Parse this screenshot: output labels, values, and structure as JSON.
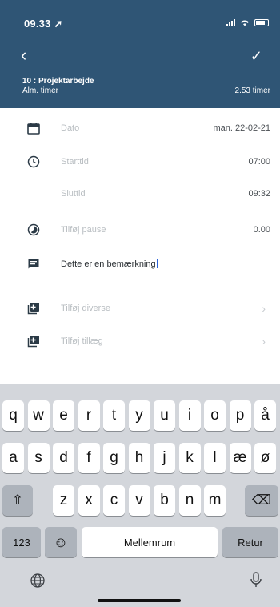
{
  "status_bar": {
    "time": "09.33"
  },
  "header": {
    "project_title": "10 : Projektarbejde",
    "hour_type": "Alm. timer",
    "total_hours": "2.53 timer"
  },
  "form": {
    "date_label": "Dato",
    "date_value": "man. 22-02-21",
    "start_label": "Starttid",
    "start_value": "07:00",
    "end_label": "Sluttid",
    "end_value": "09:32",
    "pause_label": "Tilføj pause",
    "pause_value": "0.00",
    "remark_value": "Dette er en bemærkning",
    "misc_label": "Tilføj diverse",
    "supplement_label": "Tilføj tillæg"
  },
  "keyboard": {
    "row1": [
      "q",
      "w",
      "e",
      "r",
      "t",
      "y",
      "u",
      "i",
      "o",
      "p",
      "å"
    ],
    "row2": [
      "a",
      "s",
      "d",
      "f",
      "g",
      "h",
      "j",
      "k",
      "l",
      "æ",
      "ø"
    ],
    "row3": [
      "z",
      "x",
      "c",
      "v",
      "b",
      "n",
      "m"
    ],
    "numbers_key": "123",
    "space_key": "Mellemrum",
    "return_key": "Retur"
  },
  "colors": {
    "header_bg": "#2f5575",
    "keyboard_bg": "#d3d6db"
  }
}
